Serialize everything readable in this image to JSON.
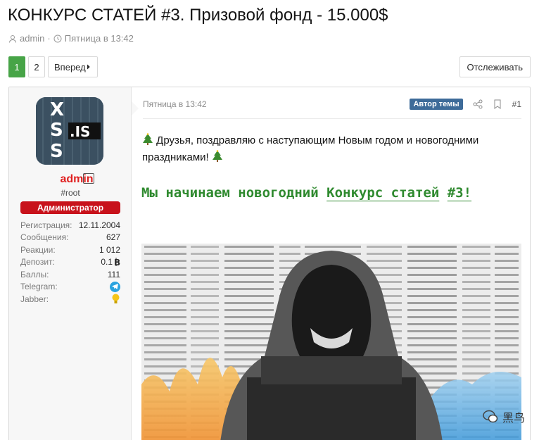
{
  "thread": {
    "title": "КОНКУРС СТАТЕЙ #3. Призовой фонд - 15.000$",
    "author": "admin",
    "date": "Пятница в 13:42"
  },
  "pagination": {
    "pages": [
      "1",
      "2"
    ],
    "current": "1",
    "next_label": "Вперед"
  },
  "watch_label": "Отслеживать",
  "post": {
    "date": "Пятница в 13:42",
    "author_badge": "Автор темы",
    "number": "#1",
    "greeting": "Друзья, поздравляю с наступающим Новым годом и новогодними праздниками!",
    "headline_plain": "Мы начинаем новогодний",
    "headline_link_1": "Конкурс статей",
    "headline_link_2": "#3!"
  },
  "user": {
    "name": "admin",
    "title": "#root",
    "banner": "Администратор",
    "avatar_text": ".IS",
    "stats": [
      {
        "label": "Регистрация:",
        "value": "12.11.2004"
      },
      {
        "label": "Сообщения:",
        "value": "627"
      },
      {
        "label": "Реакции:",
        "value": "1 012"
      },
      {
        "label": "Депозит:",
        "value": "0.1"
      },
      {
        "label": "Баллы:",
        "value": "111"
      },
      {
        "label": "Telegram:",
        "value": ""
      },
      {
        "label": "Jabber:",
        "value": ""
      }
    ]
  },
  "watermark": {
    "text": "黑鸟"
  },
  "colors": {
    "accent_green": "#47a447",
    "admin_red": "#e02020",
    "banner_red": "#c8121b",
    "badge_blue": "#3d6b99",
    "headline_green": "#2f8a2f"
  }
}
